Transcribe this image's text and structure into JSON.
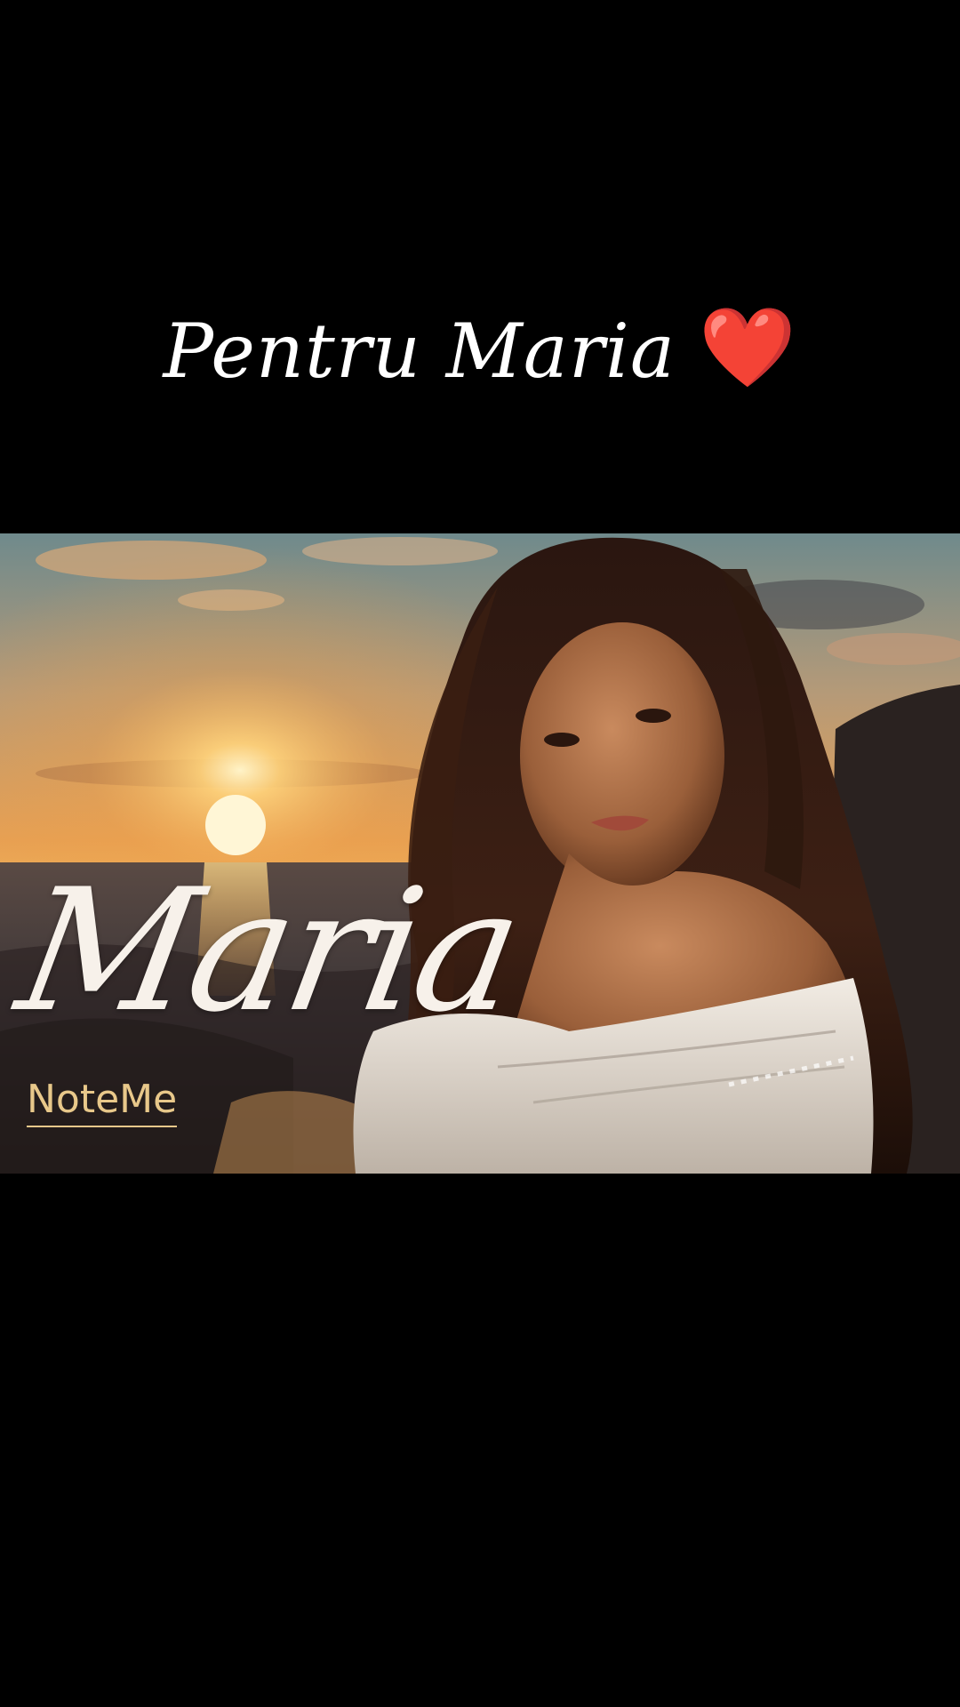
{
  "caption": {
    "text": "Pentru Maria",
    "emoji": "❤️",
    "emoji_icon": "red-heart-icon"
  },
  "photo": {
    "name_overlay": "Maria",
    "brand": "NoteMe",
    "colors": {
      "sky_top": "#6f8a8c",
      "sun": "#ffd27a",
      "sea": "#3a3a3e",
      "brand_gold": "#e8c88a"
    }
  }
}
